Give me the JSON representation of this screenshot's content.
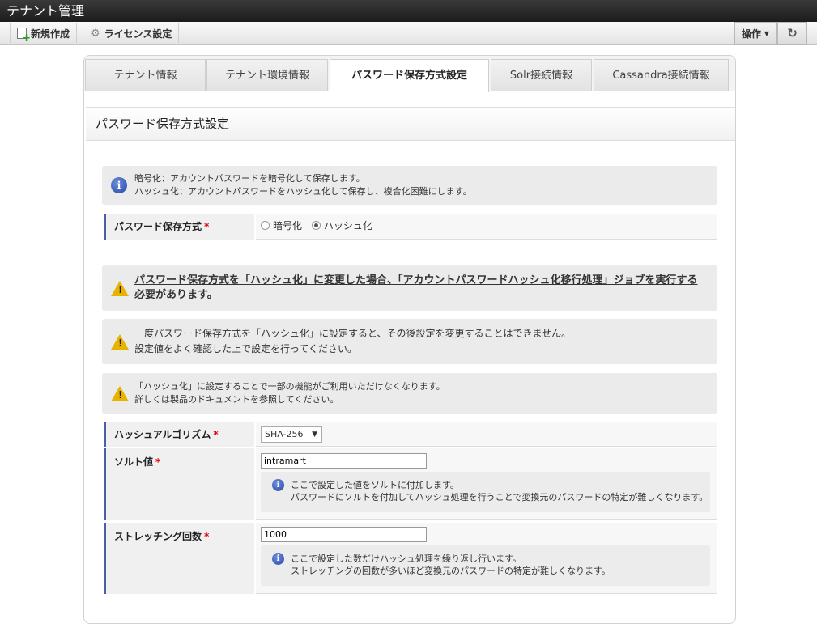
{
  "app": {
    "title": "テナント管理"
  },
  "toolbar": {
    "new_label": "新規作成",
    "license_label": "ライセンス設定",
    "operation_label": "操作",
    "refresh_glyph": "↻"
  },
  "tabs": [
    {
      "label": "テナント情報"
    },
    {
      "label": "テナント環境情報"
    },
    {
      "label": "パスワード保存方式設定"
    },
    {
      "label": "Solr接続情報"
    },
    {
      "label": "Cassandra接続情報"
    }
  ],
  "section": {
    "title": "パスワード保存方式設定"
  },
  "info_message": {
    "line1": "暗号化：アカウントパスワードを暗号化して保存します。",
    "line2": "ハッシュ化：アカウントパスワードをハッシュ化して保存し、複合化困難にします。"
  },
  "storage_method": {
    "label": "パスワード保存方式",
    "required_mark": "*",
    "options": [
      {
        "label": "暗号化",
        "selected": false
      },
      {
        "label": "ハッシュ化",
        "selected": true
      }
    ]
  },
  "warnings": {
    "w1": "パスワード保存方式を「ハッシュ化」に変更した場合、「アカウントパスワードハッシュ化移行処理」ジョブを実行する必要があります。",
    "w2_line1": "一度パスワード保存方式を「ハッシュ化」に設定すると、その後設定を変更することはできません。",
    "w2_line2": "設定値をよく確認した上で設定を行ってください。",
    "w3_line1": "「ハッシュ化」に設定することで一部の機能がご利用いただけなくなります。",
    "w3_line2": "詳しくは製品のドキュメントを参照してください。"
  },
  "hash_algorithm": {
    "label": "ハッシュアルゴリズム",
    "required_mark": "*",
    "value": "SHA-256",
    "arrow": "▼"
  },
  "salt": {
    "label": "ソルト値",
    "required_mark": "*",
    "value": "intramart",
    "hint_line1": "ここで設定した値をソルトに付加します。",
    "hint_line2": "パスワードにソルトを付加してハッシュ処理を行うことで変換元のパスワードの特定が難しくなります。"
  },
  "stretching": {
    "label": "ストレッチング回数",
    "required_mark": "*",
    "value": "1000",
    "hint_line1": "ここで設定した数だけハッシュ処理を繰り返し行います。",
    "hint_line2": "ストレッチングの回数が多いほど変換元のパスワードの特定が難しくなります。"
  }
}
